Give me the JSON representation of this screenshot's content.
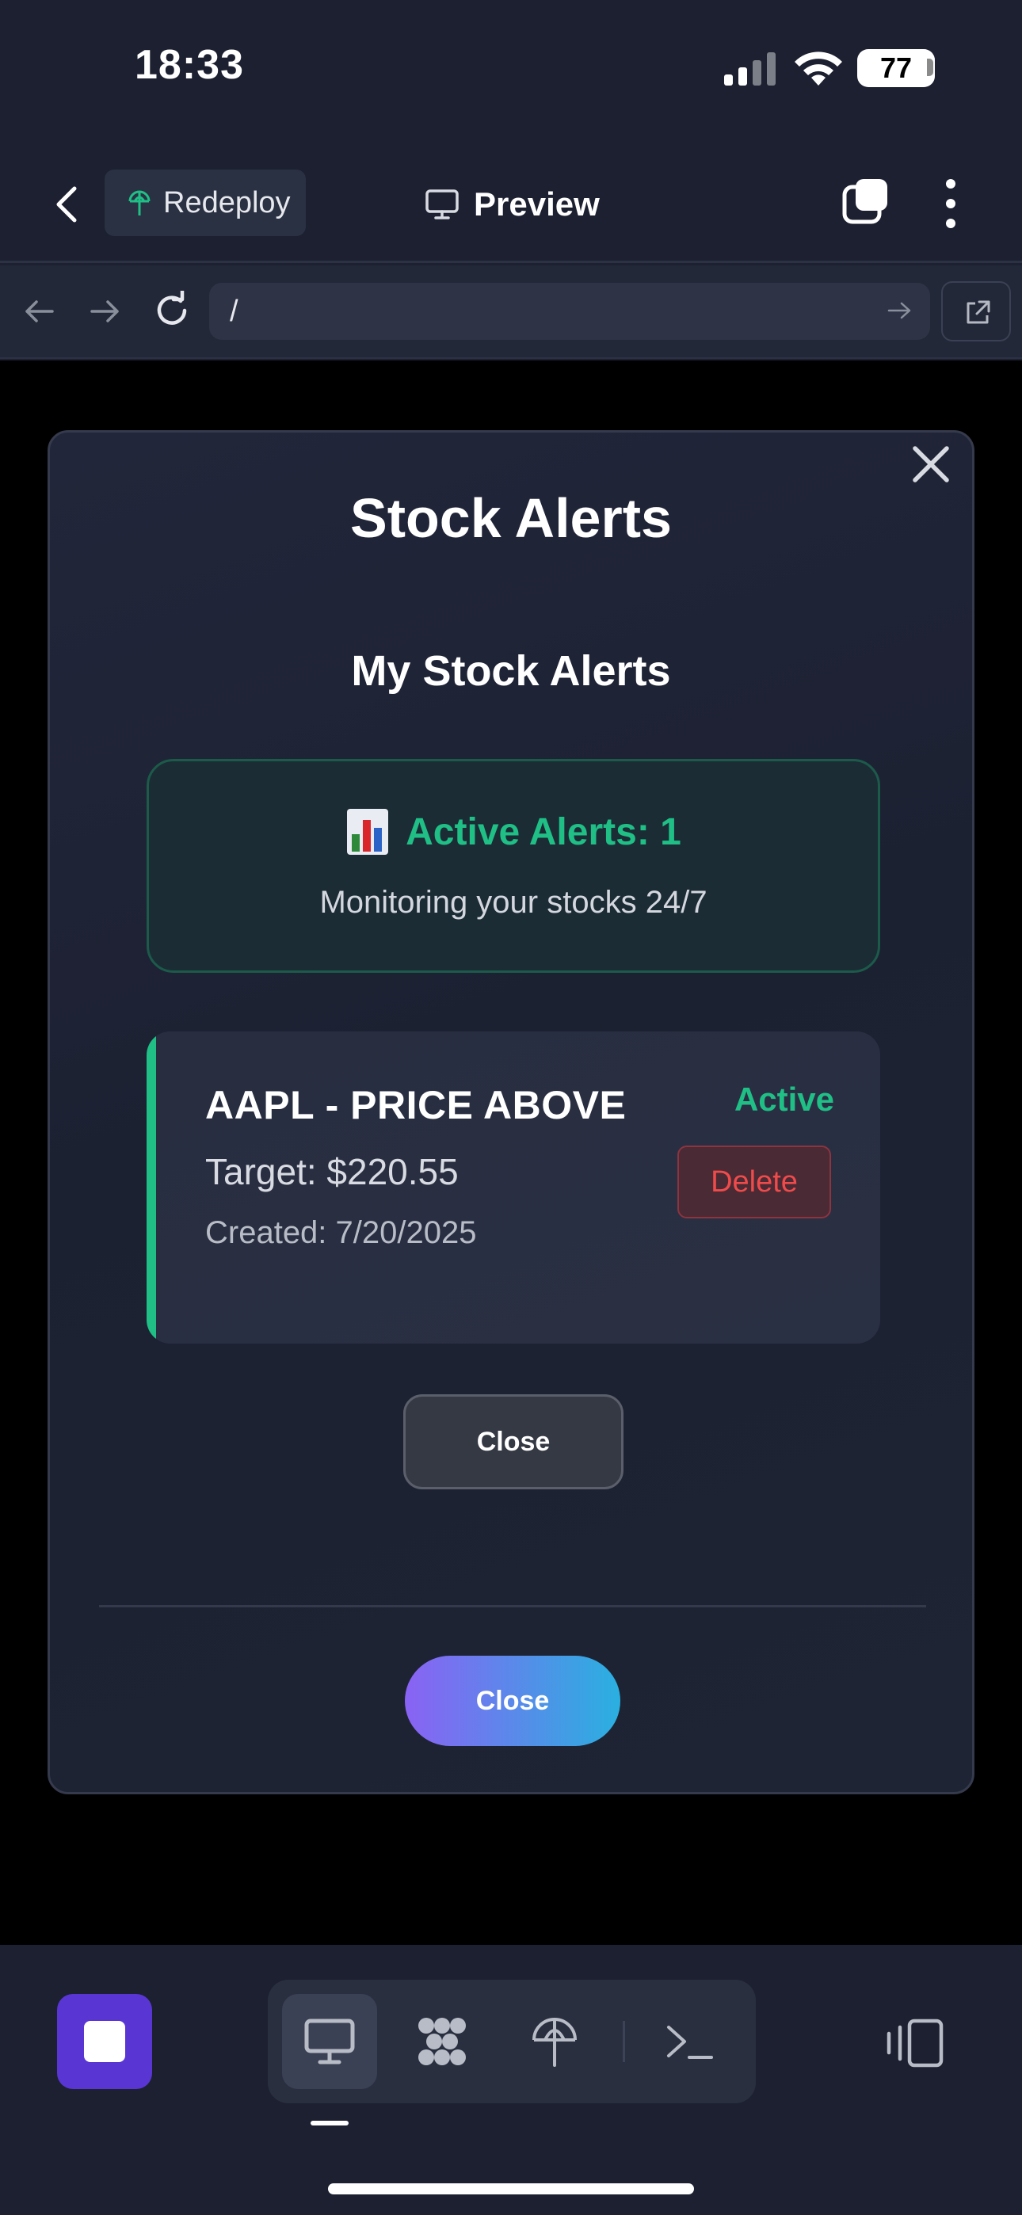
{
  "status_bar": {
    "time": "18:33",
    "battery": "77"
  },
  "header": {
    "redeploy_label": "Redeploy",
    "title": "Preview"
  },
  "url_bar": {
    "value": "/"
  },
  "modal": {
    "title": "Stock Alerts",
    "section_title": "My Stock Alerts",
    "summary": {
      "count_label": "Active Alerts: 1",
      "subtitle": "Monitoring your stocks 24/7"
    },
    "alerts": [
      {
        "heading": "AAPL - PRICE ABOVE",
        "target": "Target: $220.55",
        "created": "Created: 7/20/2025",
        "status": "Active",
        "delete_label": "Delete"
      }
    ],
    "close_secondary_label": "Close",
    "close_primary_label": "Close"
  },
  "colors": {
    "accent_green": "#1fbf86",
    "delete_red": "#ef4b4b",
    "stop_purple": "#5936d4",
    "gradient_start": "#8a62f4",
    "gradient_end": "#2ab0e0"
  },
  "icons": {
    "back": "chevron-left-icon",
    "redeploy": "globe-antenna-icon",
    "preview": "monitor-icon",
    "tabs": "tabs-icon",
    "more": "more-vertical-icon",
    "nav_back": "arrow-left-icon",
    "nav_forward": "arrow-right-icon",
    "reload": "reload-icon",
    "go": "arrow-right-icon",
    "open_external": "external-link-icon",
    "modal_close": "close-icon",
    "summary": "bar-chart-icon",
    "stop": "stop-icon",
    "tool_preview": "monitor-icon",
    "tool_extensions": "nodes-icon",
    "tool_deploy": "globe-antenna-icon",
    "tool_terminal": "terminal-icon",
    "layout": "layout-panels-icon"
  }
}
